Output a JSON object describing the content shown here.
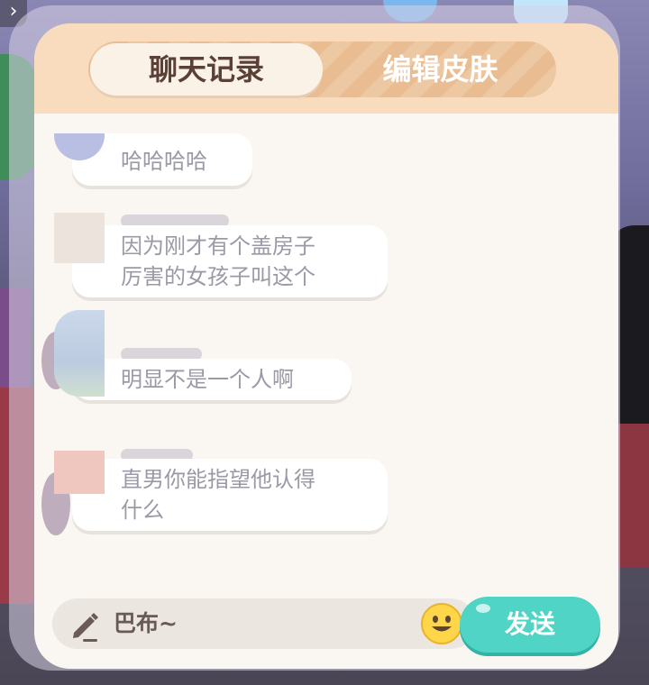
{
  "tabs": {
    "chat_log": "聊天记录",
    "edit_skin": "编辑皮肤"
  },
  "messages": [
    {
      "text_line1": "哈哈哈哈",
      "text_line2": ""
    },
    {
      "text_line1": "因为刚才有个盖房子",
      "text_line2": "厉害的女孩子叫这个"
    },
    {
      "text_line1": "明显不是一个人啊",
      "text_line2": ""
    },
    {
      "text_line1": "直男你能指望他认得",
      "text_line2": "什么"
    }
  ],
  "input": {
    "value": "巴布~"
  },
  "send_label": "发送",
  "icons": {
    "back": "chevron-right-icon",
    "pencil": "pencil-icon",
    "emoji": "smiley-icon"
  },
  "colors": {
    "tab_bar": "#f8dcbd",
    "tab_active": "#fbf2e7",
    "send_button": "#4fd4c5",
    "bubble_text": "#9a9aa6"
  }
}
